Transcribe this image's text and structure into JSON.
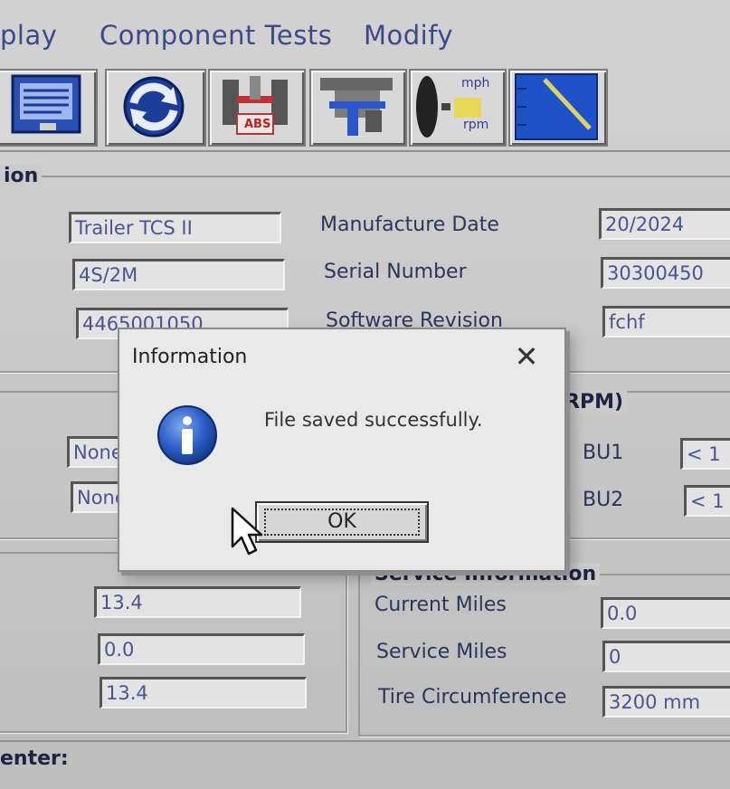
{
  "menu": {
    "display_label": "play",
    "component_tests_label": "Component Tests",
    "modify_label": "Modify"
  },
  "toolbar": {
    "abs_badge": "ABS",
    "speed_unit_top": "mph",
    "speed_unit_bottom": "rpm"
  },
  "identification": {
    "title": "ion",
    "product_name": "Trailer TCS II",
    "configuration": "4S/2M",
    "part_number": "4465001050",
    "manufacture_date_label": "Manufacture Date",
    "manufacture_date_value": "20/2024",
    "serial_number_label": "Serial Number",
    "serial_number_value": "30300450",
    "software_revision_label": "Software Revision",
    "software_revision_value": "fchf"
  },
  "sensors": {
    "title": "RPM)",
    "row1_value": "None",
    "row2_value": "None",
    "bu1_label": "BU1",
    "bu1_value": "< 1",
    "bu2_label": "BU2",
    "bu2_value": "< 1"
  },
  "voltage": {
    "field1": "13.4",
    "field2": "0.0",
    "field3": "13.4"
  },
  "service": {
    "title": "Service Information",
    "current_miles_label": "Current Miles",
    "current_miles_value": "0.0",
    "service_miles_label": "Service Miles",
    "service_miles_value": "0",
    "tire_circumference_label": "Tire Circumference",
    "tire_circumference_value": "3200 mm"
  },
  "footer": {
    "label": "enter:"
  },
  "dialog": {
    "title": "Information",
    "message": "File saved successfully.",
    "ok_label": "OK",
    "close_glyph": "✕"
  }
}
